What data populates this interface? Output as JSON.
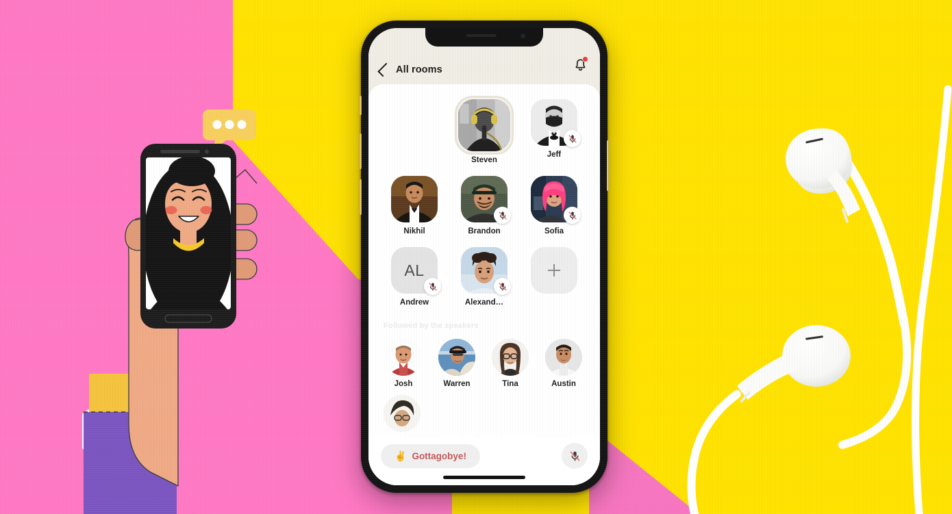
{
  "scene": {
    "description": "Promotional mockup: illustrated hand holding a phone on pink/yellow background with white earbuds, next to an iPhone showing a Clubhouse-style audio room",
    "colors": {
      "pink": "#FF78C4",
      "yellow": "#FFE200",
      "phone_frame": "#141414",
      "app_background": "#EFEDE4",
      "sheet_background": "#FFFFFF",
      "accent_red": "#EE3B3B",
      "leave_text": "#C3595A",
      "speaking_ring": "#E8E4D8"
    }
  },
  "illustration": {
    "name": "hand-holding-phone-illustration",
    "speech_bubble": {
      "name": "typing-bubble",
      "dots": 3,
      "color": "#F7CF5E"
    },
    "skin": "#EFA985",
    "hair": "#1C1C1C",
    "necklace": "#F5C828",
    "sleeve": "#7B55C0",
    "cuff": "#F5C33C"
  },
  "earbuds": {
    "name": "white-earbuds",
    "count": 2,
    "color": "#FFFFFF"
  },
  "app": {
    "statusbar": {
      "notch": true
    },
    "header": {
      "back_label": "All rooms",
      "back_icon": "chevron-left-icon",
      "bell_icon": "bell-icon",
      "has_notification": true
    },
    "speakers": [
      {
        "name": "Steven",
        "muted": false,
        "speaking": true,
        "initials": "",
        "row": 1,
        "photo": "steven-headphones-bw"
      },
      {
        "name": "Jeff",
        "muted": true,
        "speaking": false,
        "initials": "",
        "row": 1,
        "photo": "jeff-tuxedo-mask-bw"
      },
      {
        "name": "Nikhil",
        "muted": false,
        "speaking": false,
        "initials": "",
        "row": 2,
        "photo": "nikhil-tuxedo"
      },
      {
        "name": "Brandon",
        "muted": true,
        "speaking": false,
        "initials": "",
        "row": 2,
        "photo": "brandon-green-cap"
      },
      {
        "name": "Sofia",
        "muted": true,
        "speaking": false,
        "initials": "",
        "row": 2,
        "photo": "sofia-pink-wig"
      },
      {
        "name": "Andrew",
        "muted": true,
        "speaking": false,
        "initials": "AL",
        "row": 3,
        "photo": ""
      },
      {
        "name": "Alexand…",
        "muted": true,
        "speaking": false,
        "initials": "",
        "row": 3,
        "photo": "alexander-curly-hair"
      }
    ],
    "add_speaker": {
      "label": "+",
      "icon": "plus-icon"
    },
    "followed": {
      "section_title": "Followed by the speakers",
      "people": [
        {
          "name": "Josh",
          "photo": "josh-red-polo"
        },
        {
          "name": "Warren",
          "photo": "warren-cap-water"
        },
        {
          "name": "Tina",
          "photo": "tina-glasses"
        },
        {
          "name": "Austin",
          "photo": "austin-white-shirt"
        }
      ]
    },
    "bottom_bar": {
      "leave_emoji": "✌️",
      "leave_label": "Gottagobye!",
      "mic_icon": "mic-muted-icon",
      "mic_muted": true
    }
  }
}
